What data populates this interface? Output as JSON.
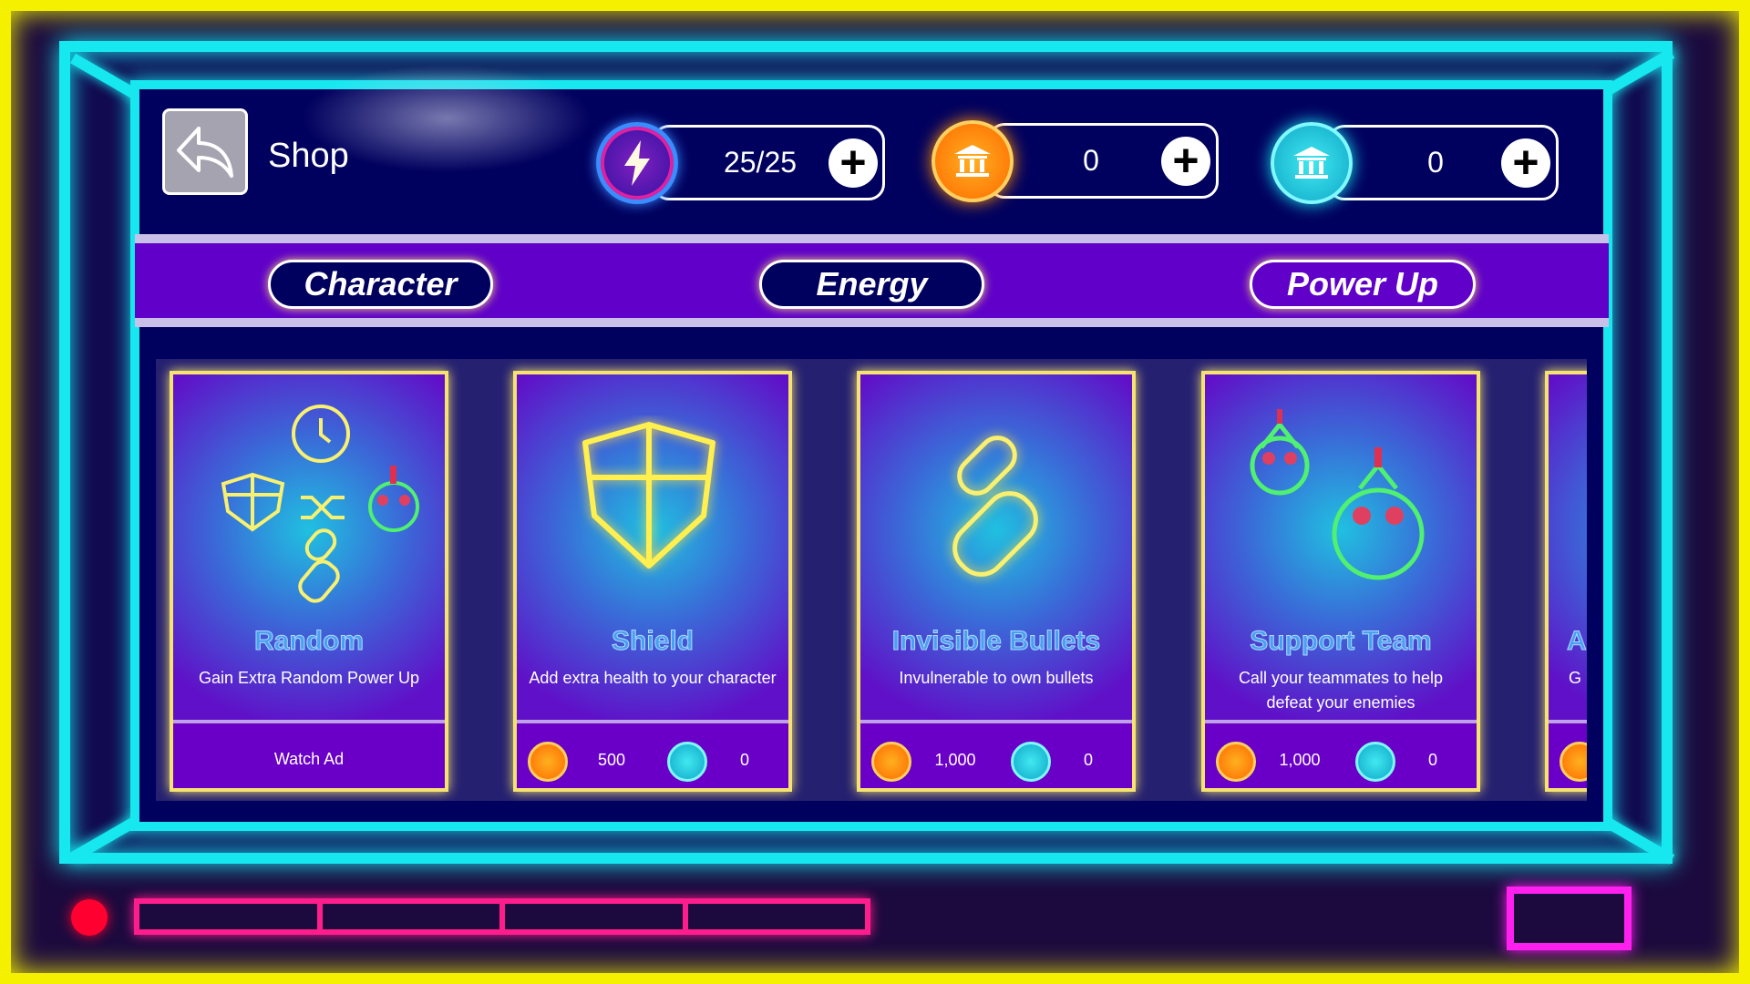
{
  "header": {
    "title": "Shop",
    "energy": "25/25",
    "gold": "0",
    "gems": "0"
  },
  "tabs": [
    {
      "label": "Character"
    },
    {
      "label": "Energy"
    },
    {
      "label": "Power Up"
    }
  ],
  "cards": [
    {
      "title": "Random",
      "desc": "Gain Extra Random Power Up",
      "action": "Watch Ad"
    },
    {
      "title": "Shield",
      "desc": "Add extra health to your character",
      "gold_price": "500",
      "gem_price": "0"
    },
    {
      "title": "Invisible Bullets",
      "desc": "Invulnerable to own bullets",
      "gold_price": "1,000",
      "gem_price": "0"
    },
    {
      "title": "Support Team",
      "desc": "Call your teammates to help defeat your enemies",
      "gold_price": "1,000",
      "gem_price": "0"
    },
    {
      "title": "A",
      "desc": "G"
    }
  ],
  "colors": {
    "neon_cyan": "#17e8f0",
    "neon_yellow": "#f4f000",
    "panel": "#00005e",
    "tab_band": "#6000c8",
    "neon_pink": "#ff1c8c"
  }
}
